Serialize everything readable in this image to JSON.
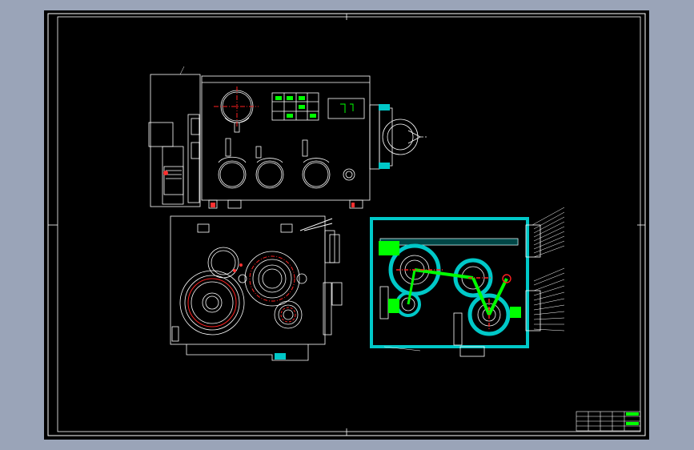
{
  "drawing": {
    "background_color": "#000000",
    "canvas_color": "#9aa4b8",
    "line_color": "#ffffff",
    "hatch_color": "#00c8c8",
    "highlight_color": "#00ff00",
    "center_line_color": "#ff2020",
    "views": [
      "front-view",
      "side-view",
      "section-view"
    ],
    "title_block": {
      "cells": [
        "",
        "",
        "",
        "",
        ""
      ]
    }
  }
}
